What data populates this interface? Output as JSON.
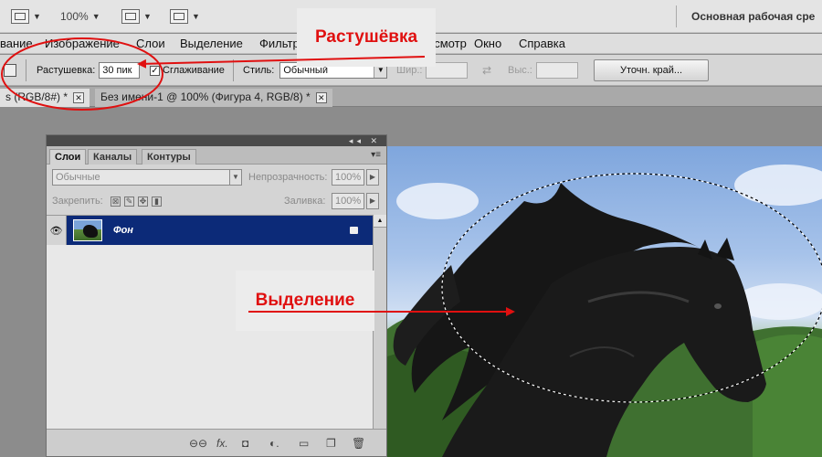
{
  "appbar": {
    "zoom": "100%",
    "workspace": "Основная рабочая сре"
  },
  "menu": [
    "вание",
    "Изображение",
    "Слои",
    "Выделение",
    "Фильтр",
    "осмотр",
    "Окно",
    "Справка"
  ],
  "options": {
    "feather_label": "Растушевка:",
    "feather_value": "30 пик",
    "antialias_label": "Сглаживание",
    "antialias_check": "✓",
    "style_label": "Стиль:",
    "style_value": "Обычный",
    "width_label": "Шир.:",
    "height_label": "Выс.:",
    "refine_button": "Уточн. край..."
  },
  "tabs": {
    "active": "s (RGB/8#) *",
    "inactive": "Без имени-1 @ 100% (Фигура 4, RGB/8) *",
    "close": "✕"
  },
  "layers_panel": {
    "tabs": [
      "Слои",
      "Каналы",
      "Контуры"
    ],
    "blend_mode": "Обычные",
    "opacity_label": "Непрозрачность:",
    "opacity_value": "100%",
    "lock_label": "Закрепить:",
    "fill_label": "Заливка:",
    "fill_value": "100%",
    "layer_name": "Фон"
  },
  "annotations": {
    "feather_callout": "Растушёвка",
    "selection_callout": "Выделение"
  },
  "colors": {
    "accent": "#e01010",
    "selected_layer": "#0c2a78"
  },
  "icons": [
    "document-icon",
    "arrange-icon",
    "screen-mode-icon",
    "eye-icon",
    "link-icon",
    "fx-icon",
    "mask-icon",
    "adjustment-icon",
    "folder-icon",
    "new-layer-icon",
    "trash-icon"
  ]
}
